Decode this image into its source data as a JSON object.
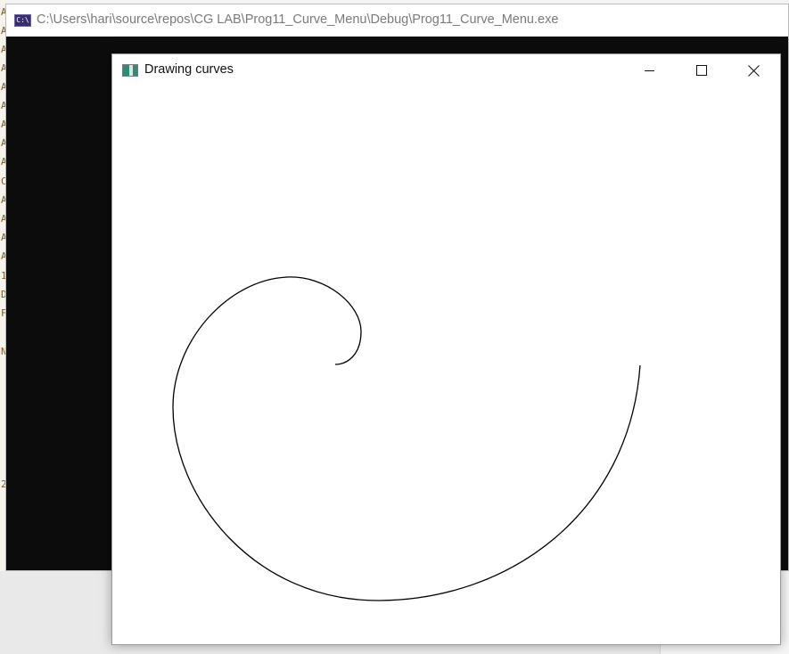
{
  "console_window": {
    "title": "C:\\Users\\hari\\source\\repos\\CG LAB\\Prog11_Curve_Menu\\Debug\\Prog11_Curve_Menu.exe",
    "icon": "console-app-icon",
    "icon_text": "C:\\"
  },
  "background": {
    "gutter_chars": [
      "A",
      "A",
      "A",
      "A",
      "A",
      "A",
      "A",
      "A",
      "A",
      "C",
      "A",
      "A",
      "A",
      "A",
      "1",
      "D",
      "F",
      "N",
      "2"
    ]
  },
  "graphics_window": {
    "title": "Drawing curves",
    "icon": "graphics-app-icon",
    "controls": {
      "minimize": "minimize-icon",
      "maximize": "maximize-icon",
      "close": "close-icon"
    },
    "curve": {
      "type": "spiral",
      "stroke_color": "#000000"
    }
  }
}
